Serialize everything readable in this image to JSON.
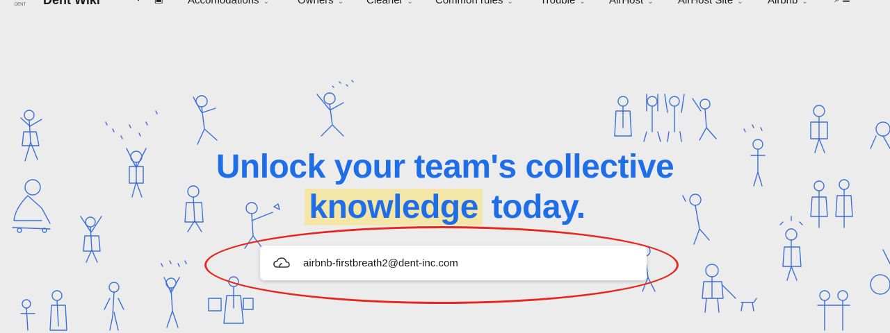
{
  "header": {
    "brand": "Dent Wiki",
    "logo_text": "DENT",
    "icons": [
      "back-icon",
      "forward-icon",
      "page-icon"
    ],
    "nav": [
      {
        "label": "Accomodations"
      },
      {
        "label": "Owners"
      },
      {
        "label": "Cleaner"
      },
      {
        "label": "Common rules"
      },
      {
        "label": "Trouble"
      },
      {
        "label": "AirHost"
      },
      {
        "label": "AirHost Site"
      },
      {
        "label": "Airbnb"
      }
    ]
  },
  "hero": {
    "line1": "Unlock your team's collective",
    "highlight": "knowledge",
    "line2_rest": " today."
  },
  "workspace_field": {
    "value": "airbnb-firstbreath2@dent-inc.com",
    "icon": "cloud-icon"
  },
  "colors": {
    "background": "#ececec",
    "headline": "#1f6ee8",
    "highlight": "#f3e6a6",
    "doodle": "#3b6fd6",
    "annotation": "#e8261e"
  }
}
